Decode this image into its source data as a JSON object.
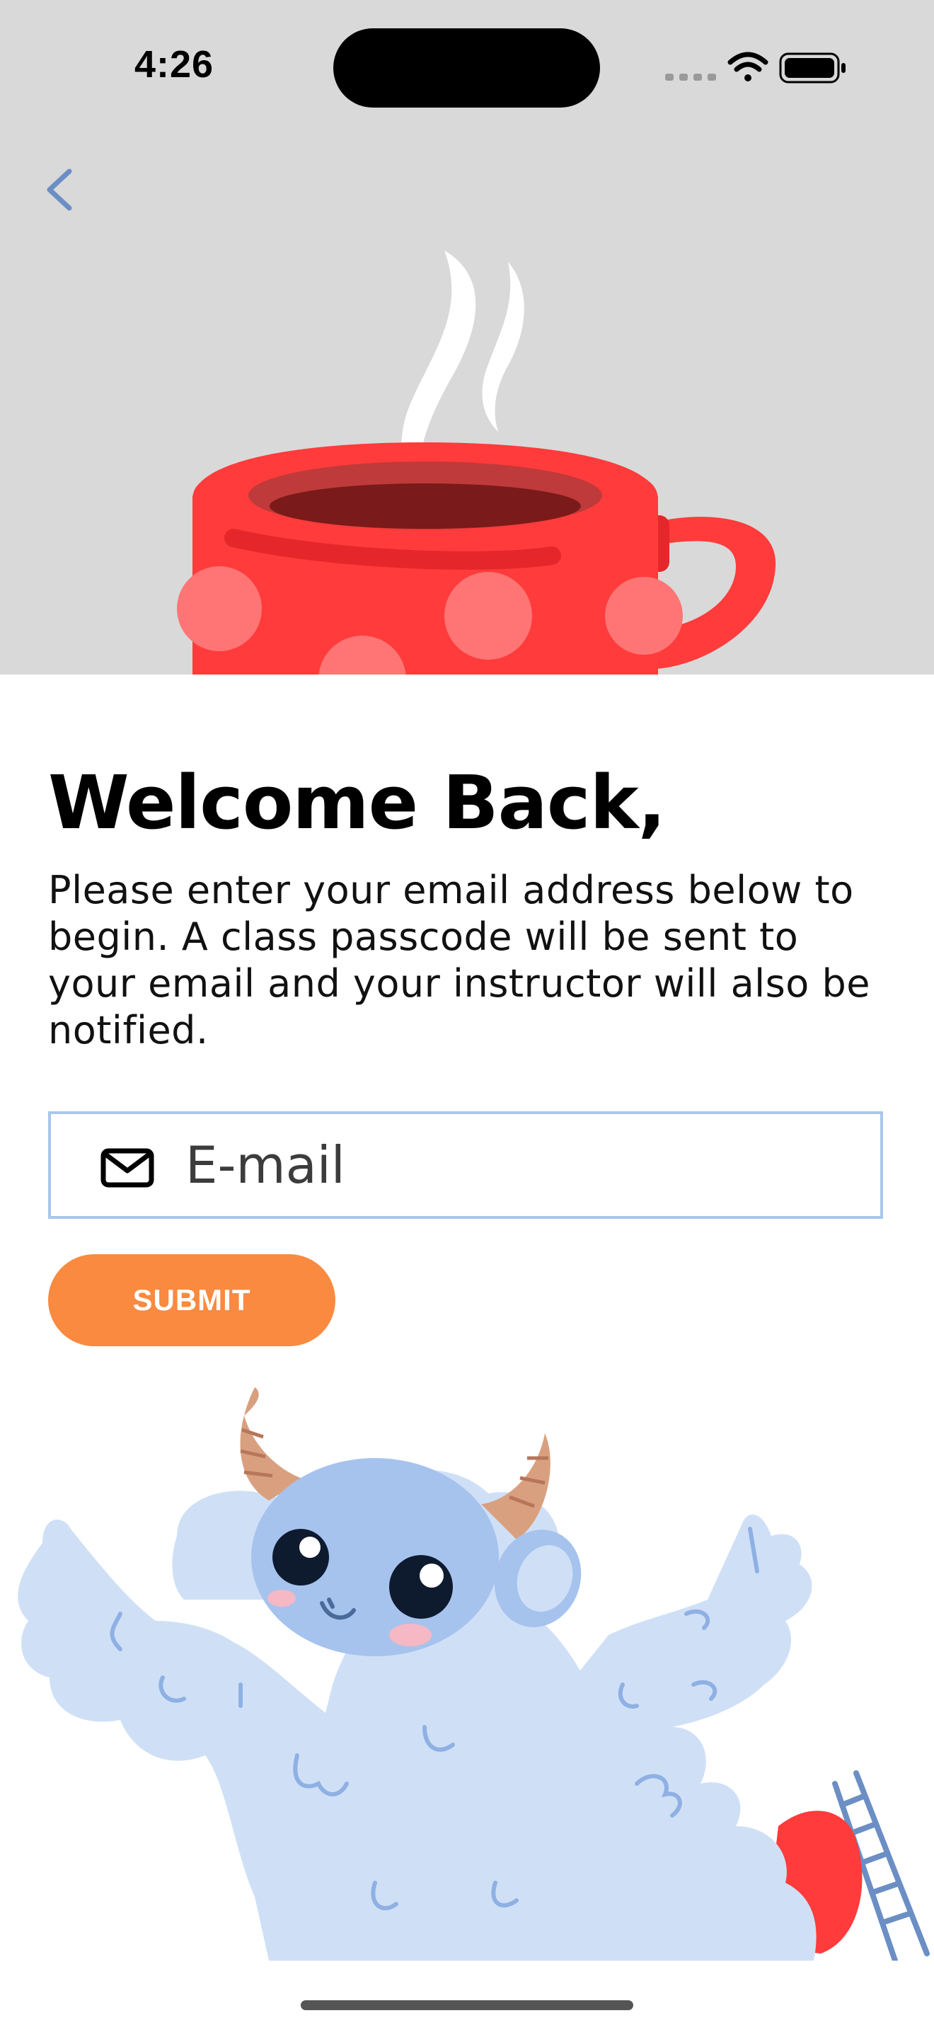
{
  "status_bar": {
    "time": "4:26",
    "icons": [
      "signal-icon",
      "wifi-icon",
      "battery-icon"
    ]
  },
  "nav": {
    "back_icon": "chevron-left-icon"
  },
  "welcome": {
    "title": "Welcome Back,",
    "description": "Please enter your email address below to begin. A class passcode will be sent to your email and your instructor will also be notified."
  },
  "form": {
    "email_icon": "mail-icon",
    "email_placeholder": "E-mail",
    "email_value": "",
    "submit_label": "SUBMIT"
  },
  "colors": {
    "hero_background": "#d9d9d9",
    "accent_orange": "#f98a40",
    "input_border": "#a9c6ef",
    "cup_red": "#ff3b3b",
    "back_chevron": "#6b8fc4"
  }
}
